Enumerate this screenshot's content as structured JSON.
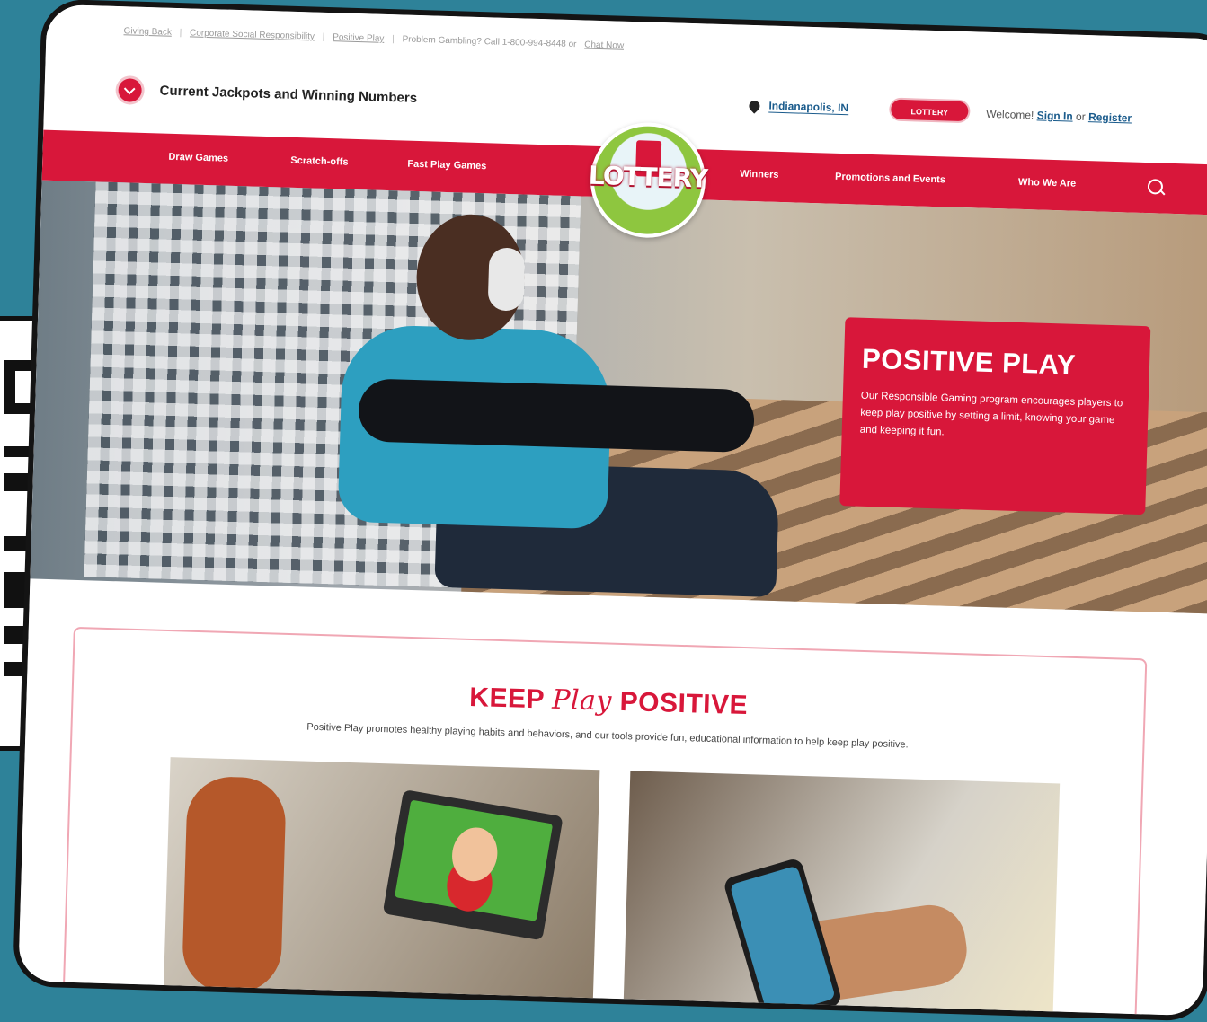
{
  "utility": {
    "giving_back": "Giving Back",
    "csr": "Corporate Social Responsibility",
    "positive_play": "Positive Play",
    "problem_gambling": "Problem Gambling? Call 1-800-994-8448 or",
    "chat_now": "Chat Now",
    "sep": "|"
  },
  "top": {
    "jackpots": "Current Jackpots and Winning Numbers",
    "location": "Indianapolis, IN",
    "mini_logo": "LOTTERY",
    "welcome": "Welcome!",
    "sign_in": "Sign In",
    "or": "or",
    "register": "Register"
  },
  "nav": {
    "items": [
      "Draw Games",
      "Scratch-offs",
      "Fast Play Games",
      "Winners",
      "Promotions and Events",
      "Who We Are"
    ],
    "logo": "LOTTERY"
  },
  "hero": {
    "title": "POSITIVE PLAY",
    "body": "Our Responsible Gaming program encourages players to keep play positive by setting a limit, knowing your game and keeping it fun."
  },
  "positive": {
    "title_a": "KEEP",
    "title_b": "Play",
    "title_c": "POSITIVE",
    "subtitle": "Positive Play promotes healthy playing habits and behaviors, and our tools provide fun, educational information to help keep play positive."
  },
  "colors": {
    "brand_red": "#d8173a",
    "link_blue": "#1a5b8c",
    "background_teal": "#2e8299"
  }
}
